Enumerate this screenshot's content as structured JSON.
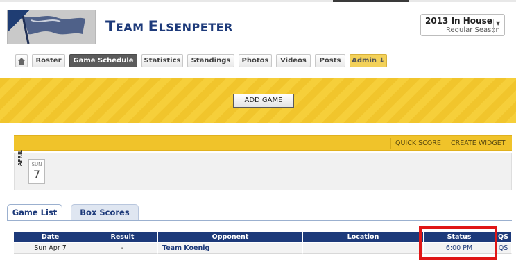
{
  "header": {
    "team_title": "Team Elsenpeter"
  },
  "season": {
    "name": "2013 In House",
    "type": "Regular Season"
  },
  "nav": {
    "items": [
      "Roster",
      "Game Schedule",
      "Statistics",
      "Standings",
      "Photos",
      "Videos",
      "Posts",
      "Admin ↓"
    ],
    "active": "Game Schedule"
  },
  "schedule": {
    "add_game_label": "ADD GAME",
    "quick_score_label": "QUICK SCORE",
    "create_widget_label": "CREATE WIDGET"
  },
  "calendar": {
    "month": "APRIL",
    "day_of_week": "SUN",
    "day_number": "7"
  },
  "subtabs": {
    "items": [
      "Game List",
      "Box Scores"
    ],
    "active": "Game List"
  },
  "table": {
    "columns": [
      "Date",
      "Result",
      "Opponent",
      "Location",
      "Status",
      "QS"
    ],
    "rows": [
      {
        "date": "Sun Apr 7",
        "result": "-",
        "opponent": "Team Koenig",
        "location": "",
        "status": "6:00 PM",
        "qs": "QS"
      }
    ]
  },
  "colors": {
    "brand_navy": "#1d3a7a",
    "accent_yellow": "#f1c52c",
    "highlight_red": "#e01616"
  }
}
